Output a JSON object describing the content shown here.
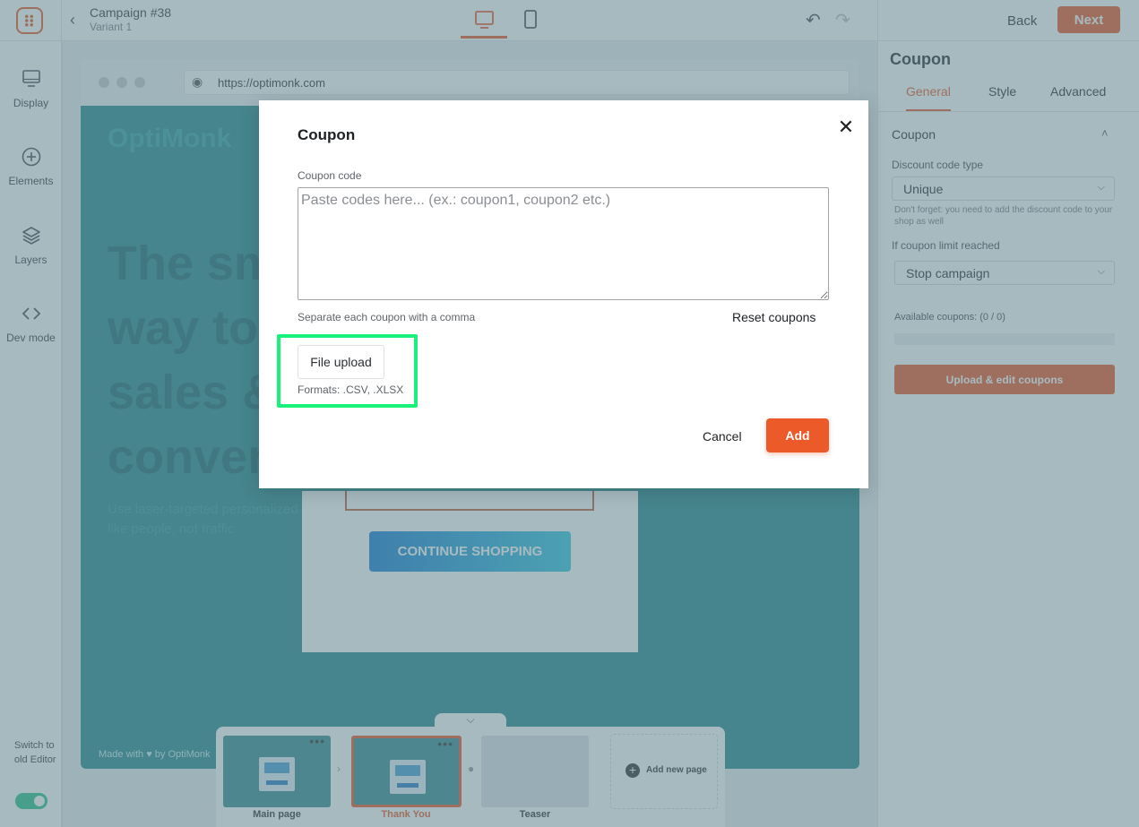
{
  "header": {
    "campaign_title": "Campaign #38",
    "variant": "Variant 1",
    "back_label": "Back",
    "next_label": "Next"
  },
  "sidebar": {
    "items": [
      {
        "label": "Display",
        "icon": "monitor-icon"
      },
      {
        "label": "Elements",
        "icon": "plus-circle-icon"
      },
      {
        "label": "Layers",
        "icon": "layers-icon"
      },
      {
        "label": "Dev mode",
        "icon": "code-icon"
      }
    ],
    "switch_label": "Switch to old Editor"
  },
  "canvas": {
    "url": "https://optimonk.com",
    "site_logo": "OptiMonk",
    "hero_text": [
      "The sm",
      "way to",
      "sales &",
      "conver"
    ],
    "hero_sub": [
      "Use laser-targeted personalized m",
      "like people, not traffic"
    ],
    "continue_button": "CONTINUE SHOPPING",
    "made_with": "Made with ♥ by OptiMonk"
  },
  "right_panel": {
    "title": "Coupon",
    "tabs": [
      "General",
      "Style",
      "Advanced"
    ],
    "section": "Coupon",
    "discount_type_label": "Discount code type",
    "discount_type_value": "Unique",
    "hint": "Don't forget: you need to add the discount code to your shop as well",
    "limit_label": "If coupon limit reached",
    "limit_value": "Stop campaign",
    "available_coupons": "Available coupons: (0 / 0)",
    "upload_button": "Upload & edit coupons"
  },
  "pages": {
    "items": [
      {
        "label": "Main page"
      },
      {
        "label": "Thank You"
      },
      {
        "label": "Teaser"
      }
    ],
    "add_label": "Add new page"
  },
  "modal": {
    "title": "Coupon",
    "code_label": "Coupon code",
    "placeholder": "Paste codes here... (ex.: coupon1, coupon2 etc.)",
    "help": "Separate each coupon with a comma",
    "reset": "Reset coupons",
    "file_upload": "File upload",
    "formats": "Formats: .CSV, .XLSX",
    "cancel": "Cancel",
    "add": "Add"
  }
}
